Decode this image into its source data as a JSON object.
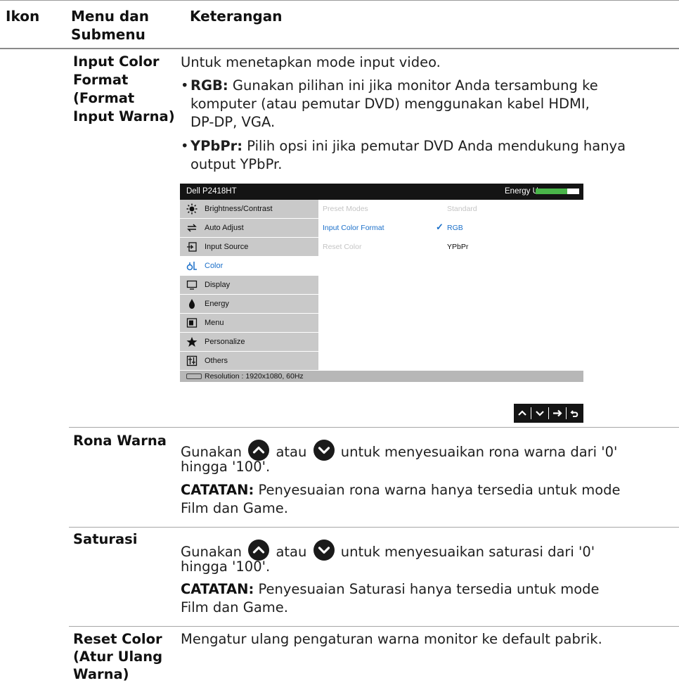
{
  "header": {
    "col_icon": "Ikon",
    "col_menu_line1": "Menu dan",
    "col_menu_line2": "Submenu",
    "col_desc": "Keterangan"
  },
  "input_color_format": {
    "name_lines": [
      "Input Color",
      "Format",
      "(Format",
      "Input Warna)"
    ],
    "intro": "Untuk menetapkan mode input video.",
    "bullet1_label": "RGB:",
    "bullet1_lines": [
      " Gunakan pilihan ini jika monitor Anda tersambung ke",
      "komputer (atau pemutar DVD) menggunakan kabel HDMI,",
      "DP-DP, VGA."
    ],
    "bullet2_label": "YPbPr:",
    "bullet2_lines": [
      " Pilih opsi ini jika pemutar DVD Anda mendukung hanya",
      "output YPbPr."
    ]
  },
  "osd": {
    "model": "Dell P2418HT",
    "energy_label": "Energy Use",
    "energy_level": 0.72,
    "menu_items": [
      {
        "label": "Brightness/Contrast",
        "icon": "sun-icon"
      },
      {
        "label": "Auto Adjust",
        "icon": "auto-adjust-icon"
      },
      {
        "label": "Input Source",
        "icon": "input-source-icon"
      },
      {
        "label": "Color",
        "icon": "color-icon",
        "selected": true
      },
      {
        "label": "Display",
        "icon": "display-icon"
      },
      {
        "label": "Energy",
        "icon": "energy-icon"
      },
      {
        "label": "Menu",
        "icon": "menu-icon"
      },
      {
        "label": "Personalize",
        "icon": "star-icon"
      },
      {
        "label": "Others",
        "icon": "others-icon"
      }
    ],
    "panel": {
      "preset_modes": "Preset Modes",
      "preset_value": "Standard",
      "input_color_format": "Input Color Format",
      "check": "✓",
      "rgb": "RGB",
      "reset_color": "Reset Color",
      "ypbpr": "YPbPr"
    },
    "resolution": "Resolution : 1920x1080, 60Hz",
    "nav_buttons": [
      "^",
      "v",
      "→",
      "ↄ"
    ],
    "colors": {
      "accent": "#1a6fc9",
      "menu_bg": "#c9c9c9",
      "energy_bar": "#4ab54a"
    }
  },
  "hue": {
    "name": "Rona Warna",
    "line1_a": "Gunakan",
    "line1_b": "atau",
    "line1_c": "untuk menyesuaikan rona warna dari '0'",
    "line2": "hingga '100'.",
    "note_label": "CATATAN:",
    "note_line1": " Penyesuaian rona warna hanya tersedia untuk mode",
    "note_line2": "Film dan Game."
  },
  "saturation": {
    "name": "Saturasi",
    "line1_a": "Gunakan",
    "line1_b": "atau",
    "line1_c": "untuk menyesuaikan saturasi dari '0'",
    "line2": "hingga '100'.",
    "note_label": "CATATAN:",
    "note_line1": " Penyesuaian Saturasi hanya tersedia untuk mode",
    "note_line2": "Film dan Game."
  },
  "reset_color": {
    "name_lines": [
      "Reset Color",
      "(Atur Ulang",
      "Warna)"
    ],
    "desc": "Mengatur ulang pengaturan warna monitor ke default pabrik."
  }
}
